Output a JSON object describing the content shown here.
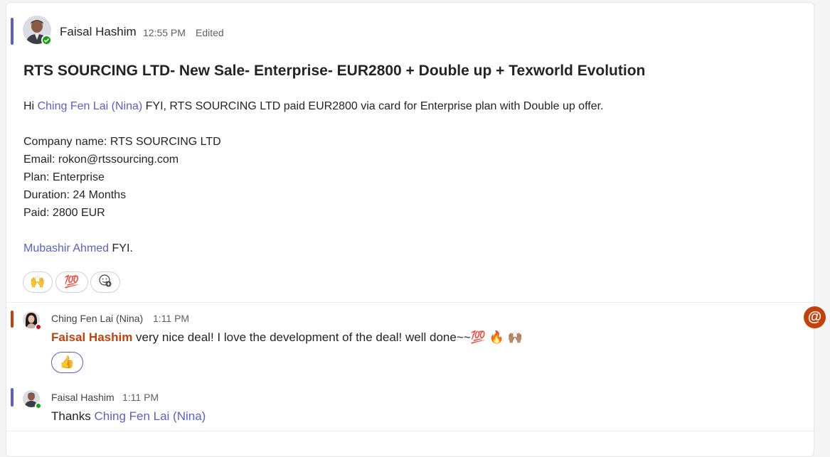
{
  "message": {
    "author": "Faisal Hashim",
    "time": "12:55 PM",
    "edited": "Edited",
    "subject": "RTS SOURCING LTD- New Sale- Enterprise- EUR2800 + Double up + Texworld Evolution",
    "greeting_prefix": "Hi ",
    "greeting_mention": "Ching Fen Lai (Nina)",
    "greeting_rest": " FYI, RTS SOURCING LTD paid EUR2800 via card for Enterprise plan with Double up offer.",
    "details": [
      "Company name:  RTS SOURCING LTD",
      "Email: rokon@rtssourcing.com",
      "Plan: Enterprise",
      "Duration: 24 Months",
      "Paid: 2800 EUR"
    ],
    "closing_mention": "Mubashir Ahmed",
    "closing_rest": " FYI.",
    "reactions": [
      "🙌",
      "💯"
    ]
  },
  "replies": [
    {
      "author": "Ching Fen Lai (Nina)",
      "time": "1:11 PM",
      "mention": "Faisal Hashim",
      "text": " very nice deal! I love the development of the deal! well done~~",
      "emojis": "💯 🔥 🙌🏽",
      "reaction": "👍"
    },
    {
      "author": "Faisal Hashim",
      "time": "1:11 PM",
      "prefix": "Thanks ",
      "mention": "Ching Fen Lai (Nina)"
    }
  ],
  "mention_badge": "@",
  "colors": {
    "accent": "#5b5fc7",
    "mention_accent": "#c4410c",
    "online": "#13a10e",
    "busy": "#c50f1f"
  }
}
